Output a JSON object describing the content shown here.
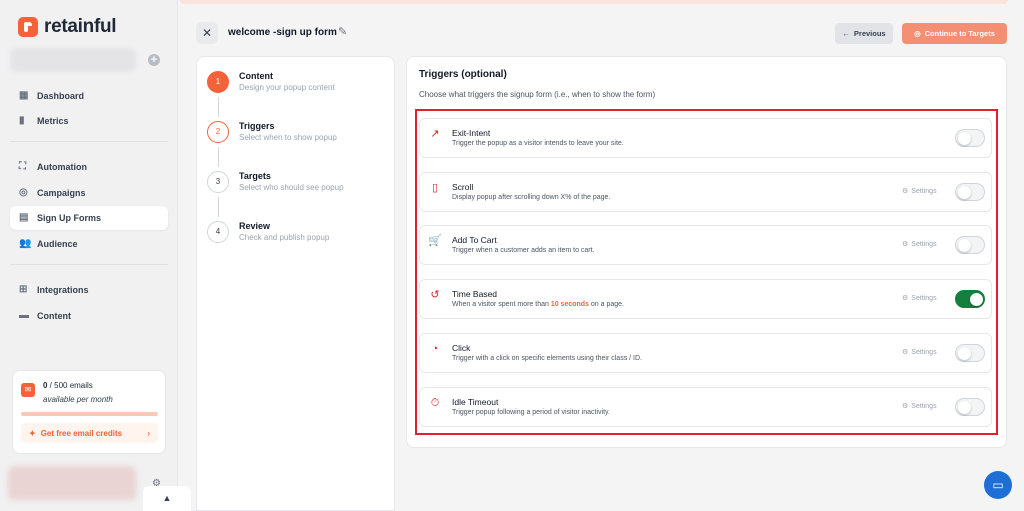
{
  "brand": {
    "name": "retainful",
    "accent": "#f4623a"
  },
  "sidebar": {
    "groups": [
      [
        {
          "label": "Dashboard",
          "icon": "dashboard-icon",
          "glyph": "▦"
        },
        {
          "label": "Metrics",
          "icon": "metrics-icon",
          "glyph": "▮"
        }
      ],
      [
        {
          "label": "Automation",
          "icon": "automation-icon",
          "glyph": "⛶"
        },
        {
          "label": "Campaigns",
          "icon": "campaigns-icon",
          "glyph": "◎"
        },
        {
          "label": "Sign Up Forms",
          "icon": "signup-forms-icon",
          "glyph": "▤",
          "active": true
        },
        {
          "label": "Audience",
          "icon": "audience-icon",
          "glyph": "👥"
        }
      ],
      [
        {
          "label": "Integrations",
          "icon": "integrations-icon",
          "glyph": "⊞"
        },
        {
          "label": "Content",
          "icon": "content-icon",
          "glyph": "▬"
        }
      ]
    ],
    "email_card": {
      "count": "0",
      "total": " / 500 emails",
      "sub": "available per month",
      "cta": "Get free email credits"
    }
  },
  "header": {
    "title": "welcome -sign up form",
    "prev_label": "Previous",
    "continue_label": "Continue to Targets"
  },
  "steps": [
    {
      "num": "1",
      "title": "Content",
      "sub": "Design your popup content",
      "state": "done"
    },
    {
      "num": "2",
      "title": "Triggers",
      "sub": "Select when to show popup",
      "state": "current"
    },
    {
      "num": "3",
      "title": "Targets",
      "sub": "Select who should see popup",
      "state": "todo"
    },
    {
      "num": "4",
      "title": "Review",
      "sub": "Check and publish popup",
      "state": "todo"
    }
  ],
  "triggers_panel": {
    "title": "Triggers (optional)",
    "subtitle": "Choose what triggers the signup form (i.e., when to show the form)",
    "settings_label": "Settings",
    "items": [
      {
        "name": "Exit-Intent",
        "desc": "Trigger the popup as a visitor intends to leave your site.",
        "icon": "exit-intent-icon",
        "glyph": "↗",
        "settings": false,
        "enabled": false
      },
      {
        "name": "Scroll",
        "desc": "Display popup after scrolling down X% of the page.",
        "icon": "mouse-scroll-icon",
        "glyph": "▯",
        "settings": true,
        "enabled": false
      },
      {
        "name": "Add To Cart",
        "desc": "Trigger when a customer adds an item to cart.",
        "icon": "cart-icon",
        "glyph": "🛒",
        "settings": true,
        "enabled": false
      },
      {
        "name": "Time Based",
        "desc_pre": "When a visitor spent more than ",
        "desc_hl": "10 seconds",
        "desc_post": " on a page.",
        "icon": "clock-history-icon",
        "glyph": "↺",
        "settings": true,
        "enabled": true
      },
      {
        "name": "Click",
        "desc": "Trigger with a click on specific elements using their class / ID.",
        "icon": "click-icon",
        "glyph": "◔",
        "settings": true,
        "enabled": false
      },
      {
        "name": "Idle Timeout",
        "desc": "Trigger popup following a period of visitor inactivity.",
        "icon": "stopwatch-icon",
        "glyph": "⏱",
        "settings": true,
        "enabled": false
      }
    ]
  }
}
